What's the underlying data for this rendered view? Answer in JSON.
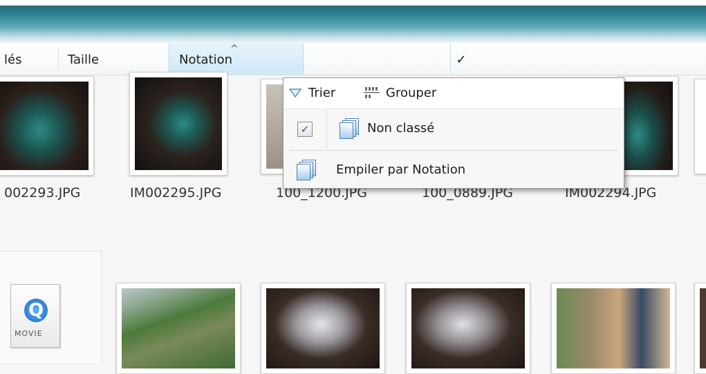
{
  "header": {
    "col_partial": "lés",
    "col_size": "Taille",
    "col_rating": "Notation",
    "sort_glyph": "^",
    "dropdown_glyph": "✓"
  },
  "files_row1": [
    {
      "name": "002293.JPG"
    },
    {
      "name": "IM002295.JPG"
    },
    {
      "name": "100_1200.JPG"
    },
    {
      "name": "100_0889.JPG"
    },
    {
      "name": "IM002294.JPG"
    }
  ],
  "menu": {
    "sort_label": "Trier",
    "group_label": "Grouper",
    "unrated_label": "Non classé",
    "unrated_checked": true,
    "check_glyph": "✓",
    "stack_label": "Empiler par Notation"
  },
  "movie": {
    "badge_glyph": "Q",
    "label": "MOVIE"
  },
  "colors": {
    "titlebar": "#2f8495",
    "selected_header": "#cfe8f6"
  }
}
